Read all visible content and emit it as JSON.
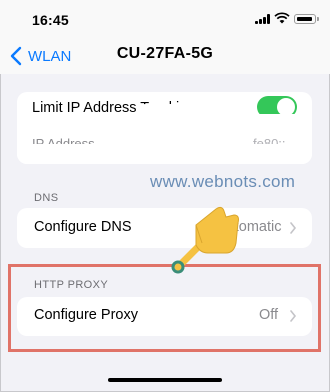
{
  "status_bar": {
    "time": "16:45"
  },
  "nav": {
    "back_label": "WLAN",
    "title": "CU-27FA-5G"
  },
  "partial_group": {
    "row1_label": "Limit IP Address Tracking",
    "toggle_on": true,
    "row2_label": "IP Address",
    "row2_value": "fe80::"
  },
  "watermark": "www.webnots.com",
  "dns": {
    "header": "DNS",
    "label": "Configure DNS",
    "value": "Automatic"
  },
  "http_proxy": {
    "header": "HTTP PROXY",
    "label": "Configure Proxy",
    "value": "Off"
  },
  "colors": {
    "accent": "#0a7aff",
    "toggle_on": "#34c759",
    "highlight": "#e07368",
    "annotation_hand": "#f5c242"
  }
}
